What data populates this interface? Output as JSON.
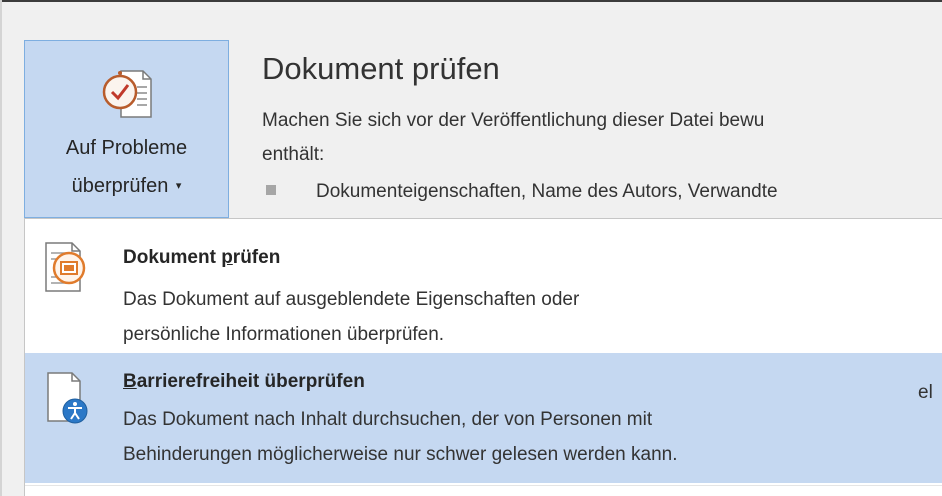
{
  "inspect_button": {
    "label_line1": "Auf Probleme",
    "label_line2": "überprüfen",
    "caret": "▾",
    "icon": "document-check-icon"
  },
  "section": {
    "title": "Dokument prüfen",
    "description_line1": "Machen Sie sich vor der Veröffentlichung dieser Datei bewu",
    "description_line2": "enthält:",
    "bullet": "Dokumenteigenschaften, Name des Autors, Verwandte"
  },
  "menu": {
    "items": [
      {
        "title_pre": "Dokument ",
        "title_underline": "p",
        "title_post": "rüfen",
        "desc_line1": "Das Dokument auf ausgeblendete Eigenschaften oder",
        "desc_line2": "persönliche Informationen überprüfen.",
        "icon": "inspect-document-icon"
      },
      {
        "title_underline": "B",
        "title_post": "arrierefreiheit überprüfen",
        "desc_line1": "Das Dokument nach Inhalt durchsuchen, der von Personen mit",
        "desc_line2": "Behinderungen möglicherweise nur schwer gelesen werden kann.",
        "icon": "accessibility-check-icon"
      }
    ]
  },
  "background_partial_text": "el",
  "colors": {
    "highlight": "#c5d8f1",
    "highlight_border": "#7eaee0",
    "background": "#f0f0f0",
    "menu_background": "#ffffff"
  }
}
